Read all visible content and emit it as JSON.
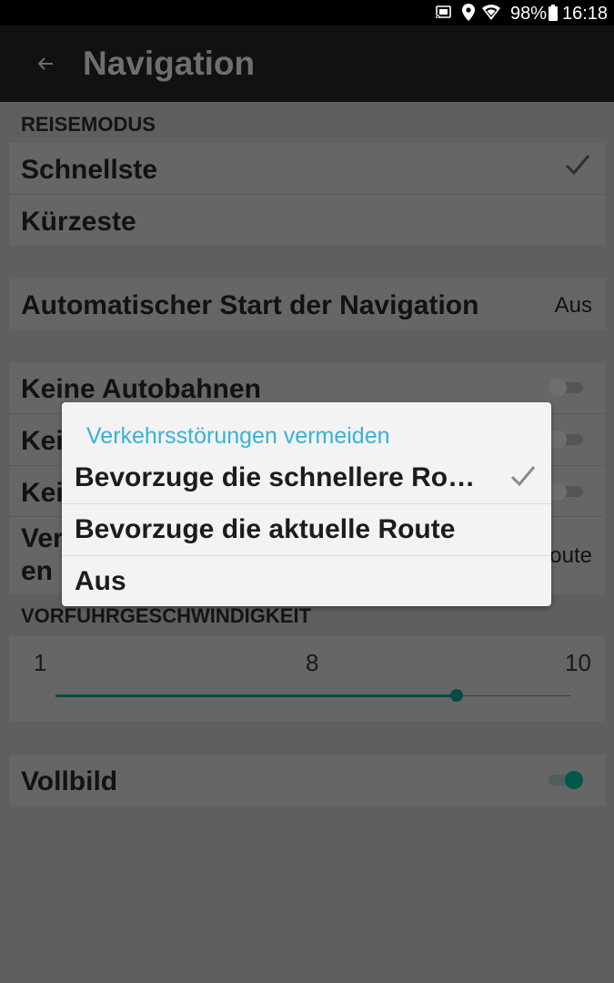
{
  "status_bar": {
    "battery_percent": "98%",
    "time": "16:18",
    "icons": [
      "cast-icon",
      "location-icon",
      "wifi-icon",
      "battery-icon"
    ]
  },
  "app_bar": {
    "title": "Navigation",
    "back_icon": "arrow-left-icon"
  },
  "reisemodus": {
    "header": "REISEMODUS",
    "options": [
      {
        "label": "Schnellste",
        "selected": true
      },
      {
        "label": "Kürzeste",
        "selected": false
      }
    ]
  },
  "auto_start": {
    "label": "Automatischer Start der Navigation",
    "value": "Aus"
  },
  "avoid": {
    "rows": [
      {
        "label": "Keine Autobahnen",
        "enabled": false
      },
      {
        "label": "Kei",
        "enabled": false
      },
      {
        "label": "Kei",
        "enabled": false
      }
    ],
    "traffic_row": {
      "label_line1": "Ver",
      "label_line2": "en",
      "value": "oute"
    }
  },
  "demo_speed": {
    "header": "VORFUHRGESCHWINDIGKEIT",
    "min_label": "1",
    "current_label": "8",
    "max_label": "10",
    "min": 1,
    "max": 10,
    "value": 8
  },
  "fullscreen": {
    "label": "Vollbild",
    "enabled": true
  },
  "dialog": {
    "title": "Verkehrsstörungen vermeiden",
    "options": [
      {
        "label": "Bevorzuge die schnellere Route",
        "selected": true
      },
      {
        "label": "Bevorzuge die aktuelle Route",
        "selected": false
      },
      {
        "label": "Aus",
        "selected": false
      }
    ]
  },
  "colors": {
    "accent": "#00574b",
    "dialog_title": "#36b2d8",
    "scrim_background": "#5f5f5f",
    "app_bar": "#111111"
  }
}
